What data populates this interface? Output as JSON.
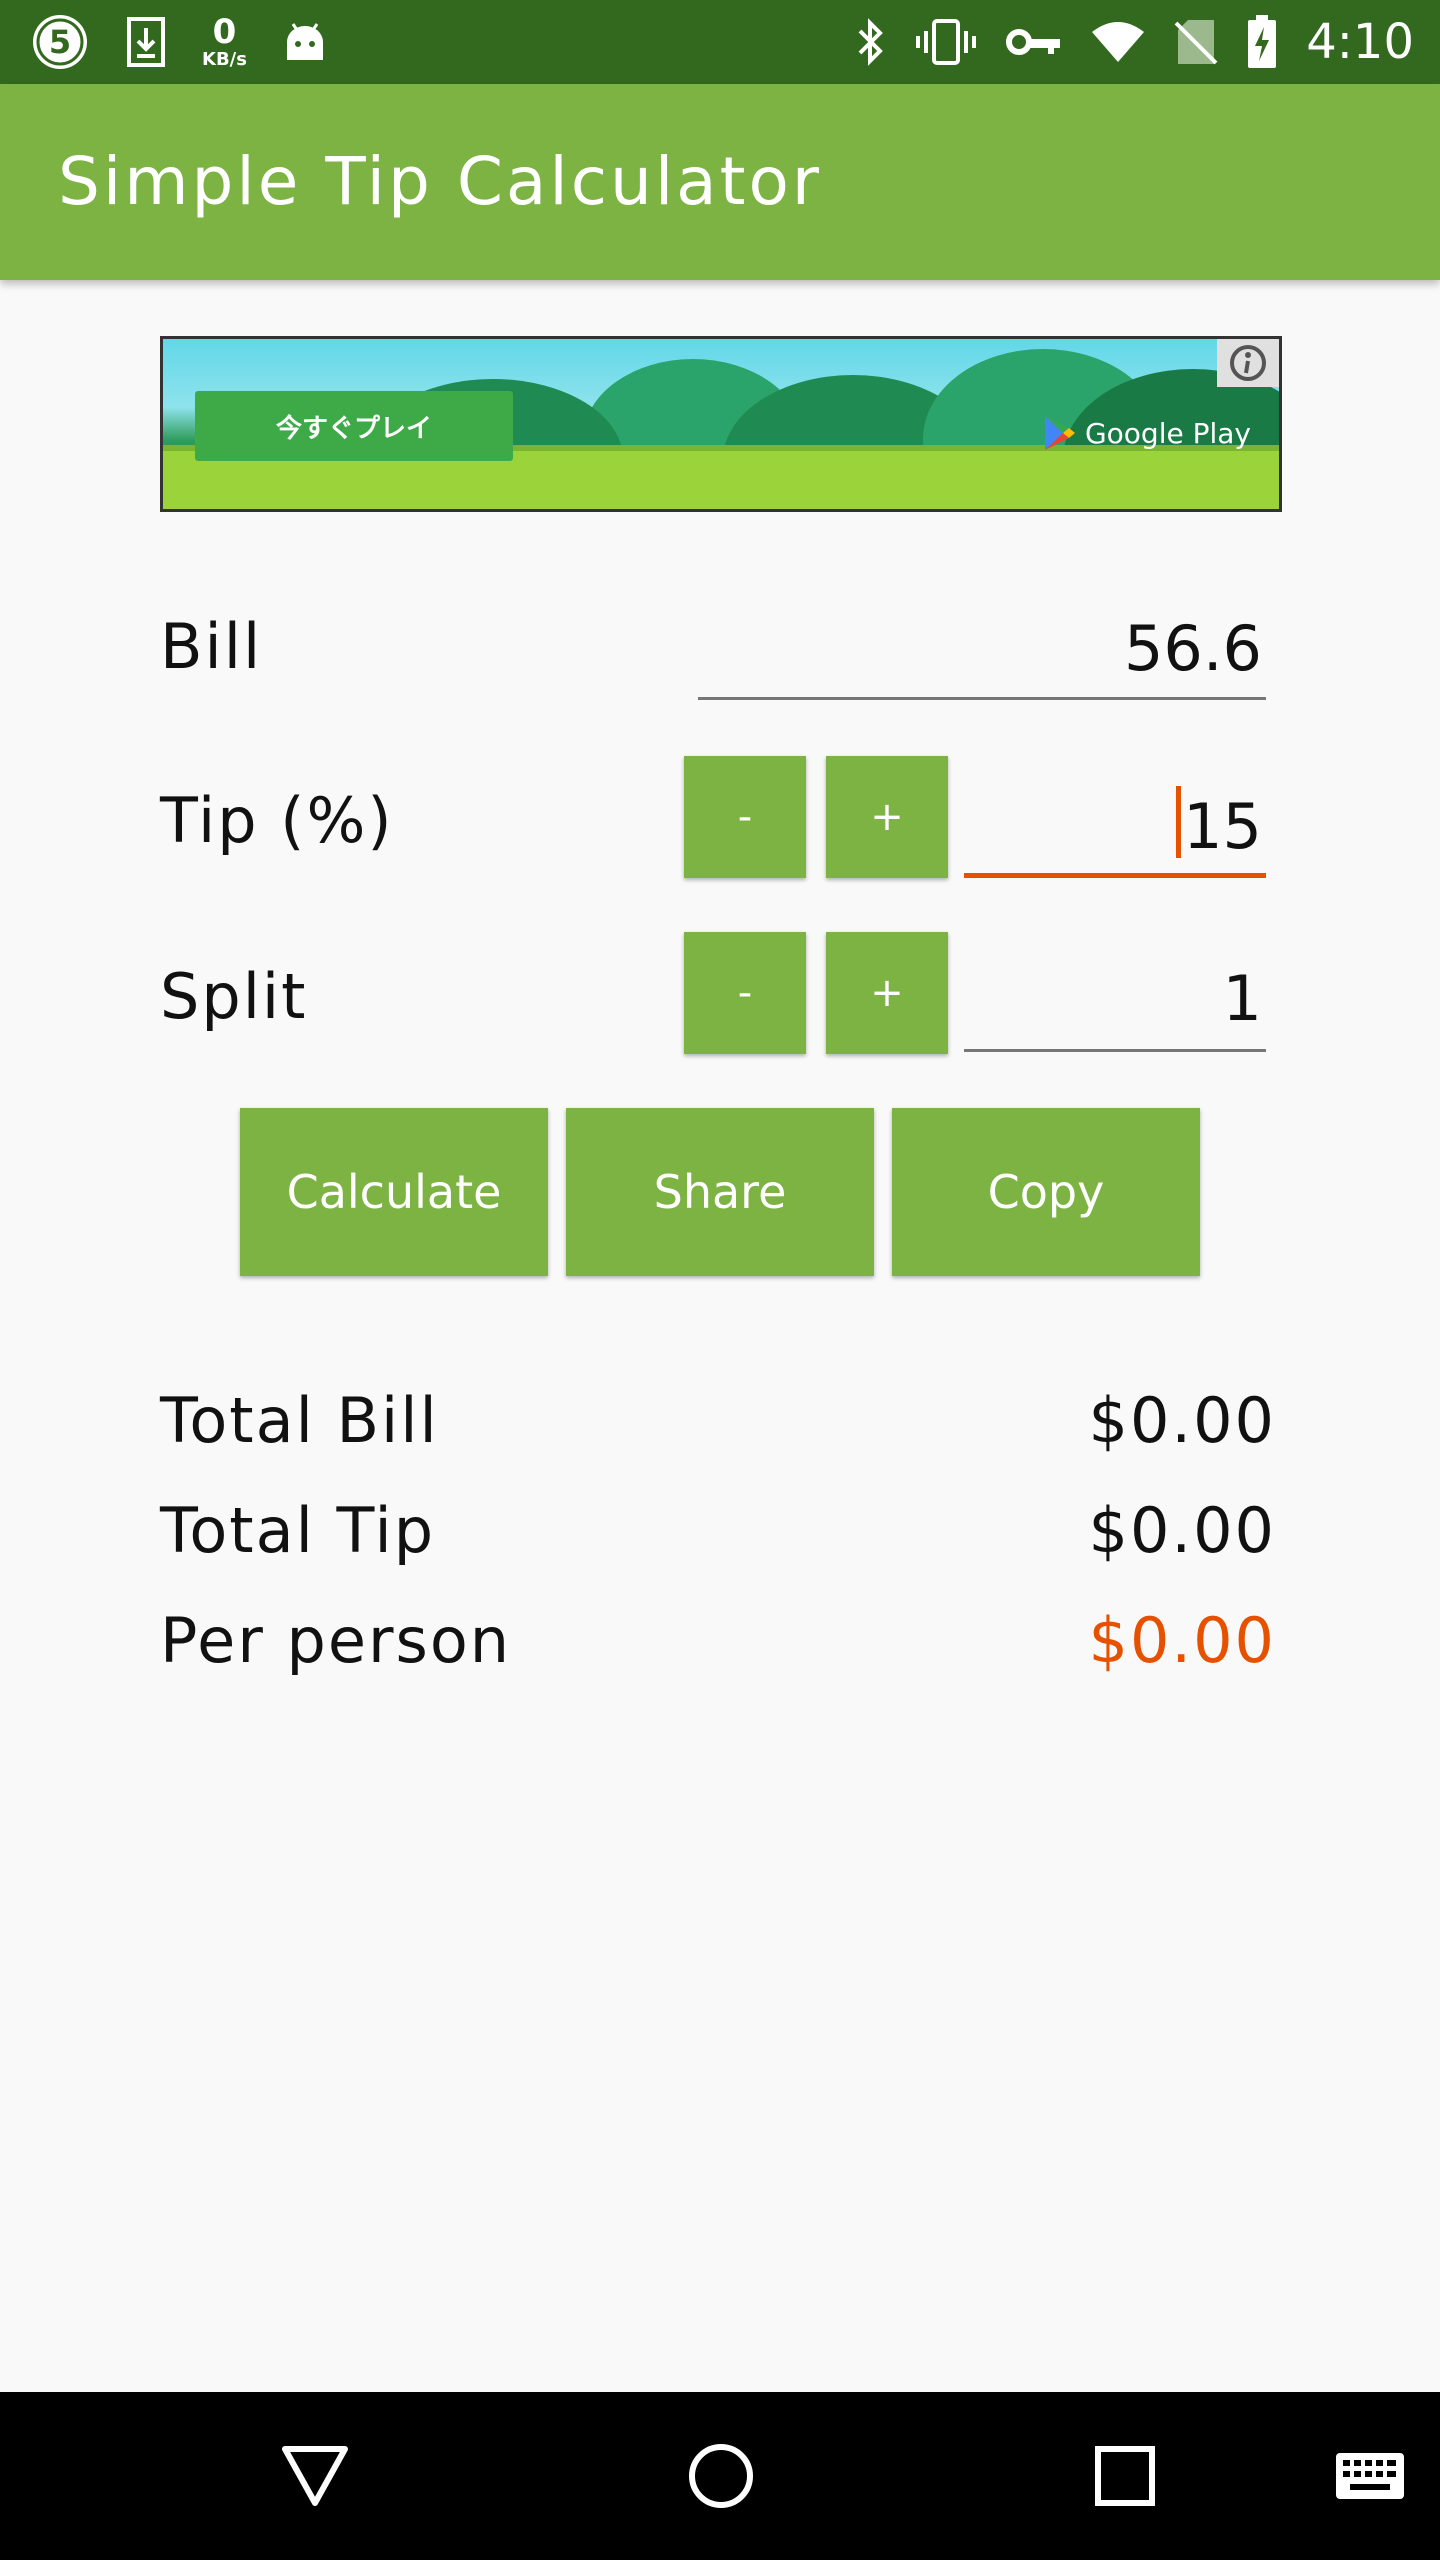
{
  "status_bar": {
    "speed_value": "0",
    "speed_unit": "KB/s",
    "time": "4:10",
    "icons": [
      "app-5-icon",
      "download-icon",
      "android-icon",
      "bluetooth-icon",
      "vibrate-icon",
      "vpn-key-icon",
      "wifi-icon",
      "no-sim-icon",
      "battery-charging-icon"
    ]
  },
  "app_bar": {
    "title": "Simple Tip Calculator"
  },
  "ad": {
    "cta_label": "今すぐプレイ",
    "store_label": "Google Play"
  },
  "form": {
    "bill": {
      "label": "Bill",
      "value": "56.6"
    },
    "tip": {
      "label": "Tip (%)",
      "minus": "-",
      "plus": "+",
      "value": "15"
    },
    "split": {
      "label": "Split",
      "minus": "-",
      "plus": "+",
      "value": "1"
    }
  },
  "actions": {
    "calculate": "Calculate",
    "share": "Share",
    "copy": "Copy"
  },
  "results": {
    "total_bill": {
      "label": "Total Bill",
      "value": "$0.00"
    },
    "total_tip": {
      "label": "Total Tip",
      "value": "$0.00"
    },
    "per_person": {
      "label": "Per person",
      "value": "$0.00"
    }
  },
  "colors": {
    "status_bar": "#33691e",
    "primary": "#7cb342",
    "accent": "#e65100",
    "background": "#f9f9f9"
  }
}
